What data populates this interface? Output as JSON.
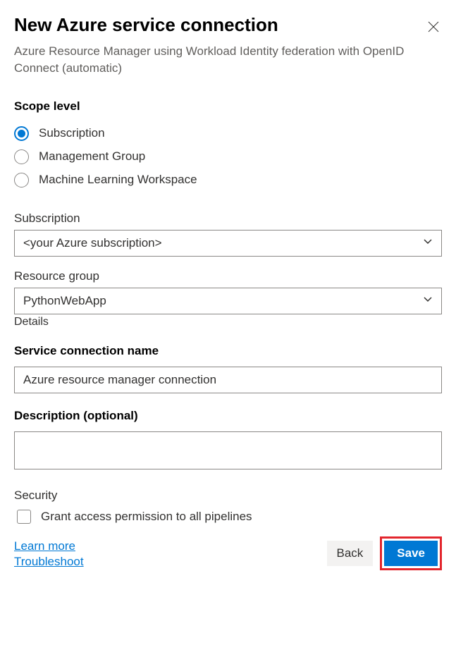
{
  "header": {
    "title": "New Azure service connection",
    "subtitle": "Azure Resource Manager using Workload Identity federation with OpenID Connect (automatic)"
  },
  "scope": {
    "label": "Scope level",
    "options": [
      {
        "label": "Subscription",
        "checked": true
      },
      {
        "label": "Management Group",
        "checked": false
      },
      {
        "label": "Machine Learning Workspace",
        "checked": false
      }
    ]
  },
  "subscription": {
    "label": "Subscription",
    "value": "<your Azure subscription>"
  },
  "resourceGroup": {
    "label": "Resource group",
    "value": "PythonWebApp",
    "helper": "Details"
  },
  "serviceConnection": {
    "label": "Service connection name",
    "value": "Azure resource manager connection"
  },
  "description": {
    "label": "Description (optional)",
    "value": ""
  },
  "security": {
    "label": "Security",
    "checkboxLabel": "Grant access permission to all pipelines"
  },
  "links": {
    "learn": "Learn more",
    "trouble": "Troubleshoot"
  },
  "buttons": {
    "back": "Back",
    "save": "Save"
  }
}
